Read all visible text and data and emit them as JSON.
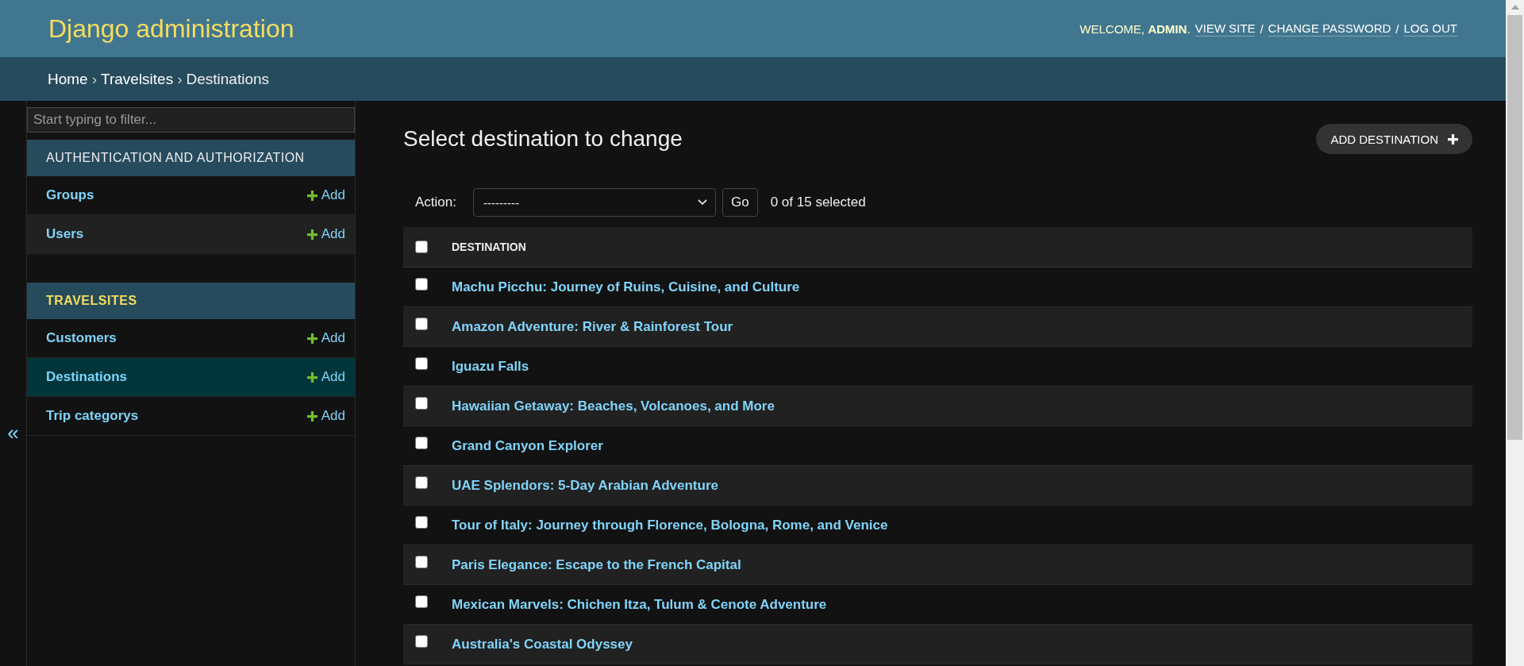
{
  "header": {
    "title": "Django administration",
    "welcome": "WELCOME, **ADMIN**.",
    "user_tools": [
      {
        "kind": "link",
        "text": "VIEW SITE"
      },
      {
        "kind": "separator",
        "text": "/"
      },
      {
        "kind": "link",
        "text": "CHANGE PASSWORD"
      },
      {
        "kind": "separator",
        "text": "/"
      },
      {
        "kind": "link",
        "text": "LOG OUT"
      }
    ]
  },
  "breadcrumbs": [
    {
      "kind": "link",
      "text": "Home"
    },
    {
      "kind": "separator",
      "text": "›"
    },
    {
      "kind": "link",
      "text": "Travelsites"
    },
    {
      "kind": "separator",
      "text": "›"
    },
    {
      "kind": "current",
      "text": "Destinations"
    }
  ],
  "sidebar": {
    "toggle": "«",
    "filter": {
      "placeholder": "Start typing to filter..."
    },
    "modules": [
      {
        "title": "AUTHENTICATION AND AUTHORIZATION",
        "selected": false,
        "items": [
          {
            "name": "Groups",
            "add": "Add",
            "selected": false
          },
          {
            "name": "Users",
            "add": "Add",
            "selected": false
          }
        ]
      },
      {
        "title": "TRAVELSITES",
        "selected": true,
        "items": [
          {
            "name": "Customers",
            "add": "Add",
            "selected": false
          },
          {
            "name": "Destinations",
            "add": "Add",
            "selected": true
          },
          {
            "name": "Trip categorys",
            "add": "Add",
            "selected": false
          }
        ]
      }
    ]
  },
  "content": {
    "title": "Select destination to change",
    "add_button": "ADD DESTINATION",
    "actions": {
      "label": "Action:",
      "value": "---------",
      "go": "Go",
      "counter": "0 of 15 selected"
    },
    "table": {
      "select_all_checked": false,
      "columns": [
        "DESTINATION"
      ],
      "rows": [
        {
          "title": "Machu Picchu: Journey of Ruins, Cuisine, and Culture",
          "checked": false
        },
        {
          "title": "Amazon Adventure: River & Rainforest Tour",
          "checked": false
        },
        {
          "title": "Iguazu Falls",
          "checked": false
        },
        {
          "title": "Hawaiian Getaway: Beaches, Volcanoes, and More",
          "checked": false
        },
        {
          "title": "Grand Canyon Explorer",
          "checked": false
        },
        {
          "title": "UAE Splendors: 5-Day Arabian Adventure",
          "checked": false
        },
        {
          "title": "Tour of Italy: Journey through Florence, Bologna, Rome, and Venice",
          "checked": false
        },
        {
          "title": "Paris Elegance: Escape to the French Capital",
          "checked": false
        },
        {
          "title": "Mexican Marvels: Chichen Itza, Tulum & Cenote Adventure",
          "checked": false
        },
        {
          "title": "Australia's Coastal Odyssey",
          "checked": false
        }
      ]
    }
  }
}
